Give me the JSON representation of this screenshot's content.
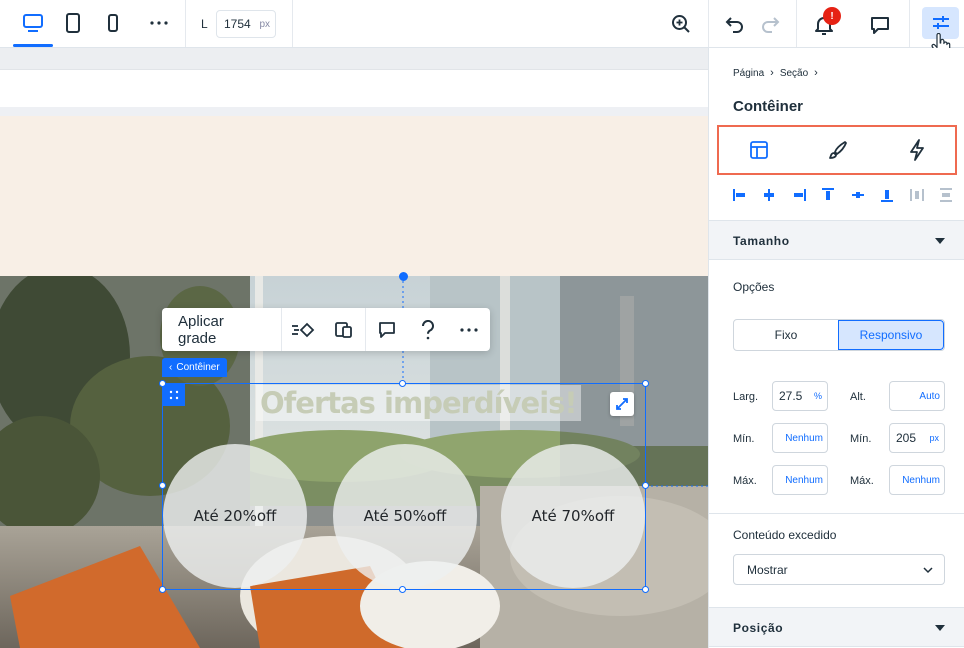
{
  "topbar": {
    "width_label": "L",
    "width_value": "1754",
    "width_unit": "px",
    "notification_badge": "!"
  },
  "canvas": {
    "toolbar": {
      "apply_grid_label": "Aplicar grade"
    },
    "container_tag": "Contêiner",
    "offer_title": "Ofertas imperdíveis!",
    "offers": [
      "Até 20%off",
      "Até 50%off",
      "Até 70%off"
    ]
  },
  "panel": {
    "breadcrumb": [
      "Página",
      "Seção"
    ],
    "title": "Contêiner",
    "size_section": {
      "label": "Tamanho",
      "options_label": "Opções",
      "options": [
        "Fixo",
        "Responsivo"
      ],
      "selected_option": "Responsivo",
      "width_label": "Larg.",
      "width_value": "27.5",
      "width_unit": "%",
      "height_label": "Alt.",
      "height_value": "Auto",
      "min_label": "Mín.",
      "min_width_value": "Nenhum",
      "min_height_value": "205",
      "min_height_unit": "px",
      "max_label": "Máx.",
      "max_width_value": "Nenhum",
      "max_height_value": "Nenhum"
    },
    "overflow_label": "Conteúdo excedido",
    "overflow_value": "Mostrar",
    "position_section": {
      "label": "Posição"
    }
  },
  "colors": {
    "accent": "#116dff",
    "highlight_border": "#ef6a50",
    "badge": "#e62214"
  }
}
